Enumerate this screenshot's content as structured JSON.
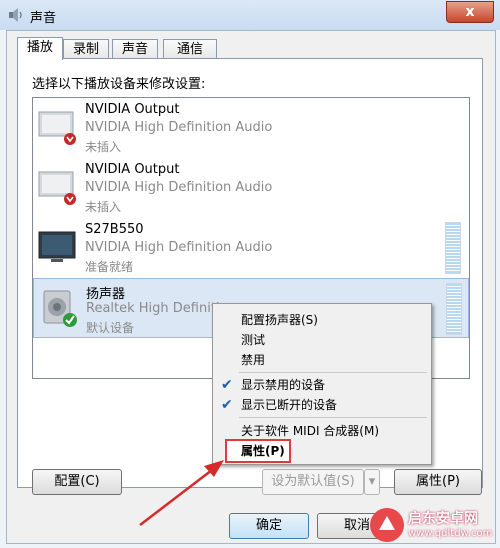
{
  "window": {
    "title": "声音",
    "close_glyph": "x"
  },
  "tabs": [
    {
      "label": "播放",
      "active": true
    },
    {
      "label": "录制",
      "active": false
    },
    {
      "label": "声音",
      "active": false
    },
    {
      "label": "通信",
      "active": false
    }
  ],
  "instruction": "选择以下播放设备来修改设置:",
  "devices": [
    {
      "name": "NVIDIA Output",
      "desc": "NVIDIA High Definition Audio",
      "status": "未插入",
      "icon": "monitor-disconnected-icon"
    },
    {
      "name": "NVIDIA Output",
      "desc": "NVIDIA High Definition Audio",
      "status": "未插入",
      "icon": "monitor-disconnected-icon"
    },
    {
      "name": "S27B550",
      "desc": "NVIDIA High Definition Audio",
      "status": "准备就绪",
      "icon": "monitor-icon"
    },
    {
      "name": "扬声器",
      "desc": "Realtek High Definitio",
      "status": "默认设备",
      "icon": "speaker-default-icon",
      "selected": true
    }
  ],
  "buttons": {
    "configure": "配置(C)",
    "set_default": "设为默认值(S)",
    "properties": "属性(P)",
    "ok": "确定",
    "cancel": "取消"
  },
  "context_menu": {
    "configure_speakers": "配置扬声器(S)",
    "test": "测试",
    "disable": "禁用",
    "show_disabled": "显示禁用的设备",
    "show_disconnected": "显示已断开的设备",
    "about_midi": "关于软件 MIDI 合成器(M)",
    "properties": "属性(P)"
  },
  "watermark": {
    "name": "启东安卓网",
    "url": "www.qdltdw.com"
  },
  "colors": {
    "highlight_box": "#e03a3a",
    "arrow": "#d62b2b",
    "check": "#1e5fa8"
  }
}
